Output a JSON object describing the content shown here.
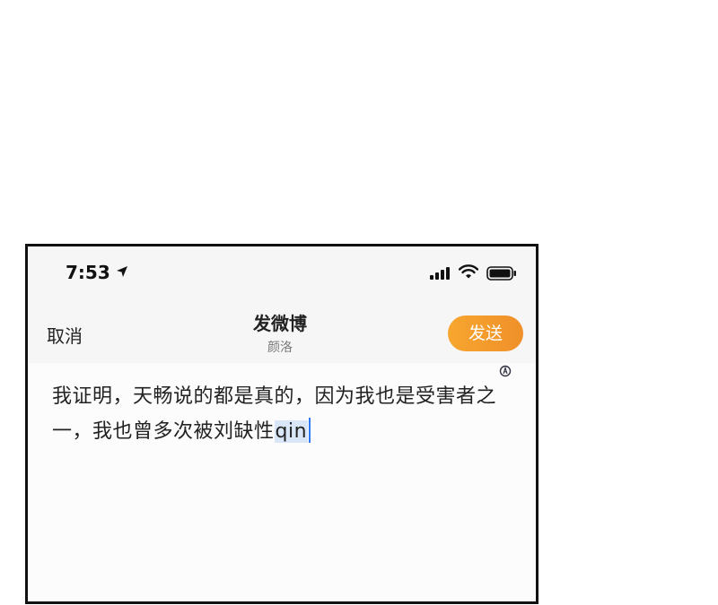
{
  "status": {
    "time": "7:53"
  },
  "nav": {
    "cancel_label": "取消",
    "title": "发微博",
    "subtitle": "颜洛",
    "send_label": "发送"
  },
  "editor": {
    "text": "我证明，天畅说的都是真的，因为我也是受害者之一，我也曾多次被刘缺性",
    "composing_text": "qin"
  },
  "colors": {
    "send_button": "#f39a2c",
    "caret": "#2f7cf6",
    "composing_highlight": "#d9e6f8"
  },
  "icons": [
    "location-arrow-icon",
    "cellular-signal-icon",
    "wifi-icon",
    "battery-icon",
    "mention-icon"
  ]
}
